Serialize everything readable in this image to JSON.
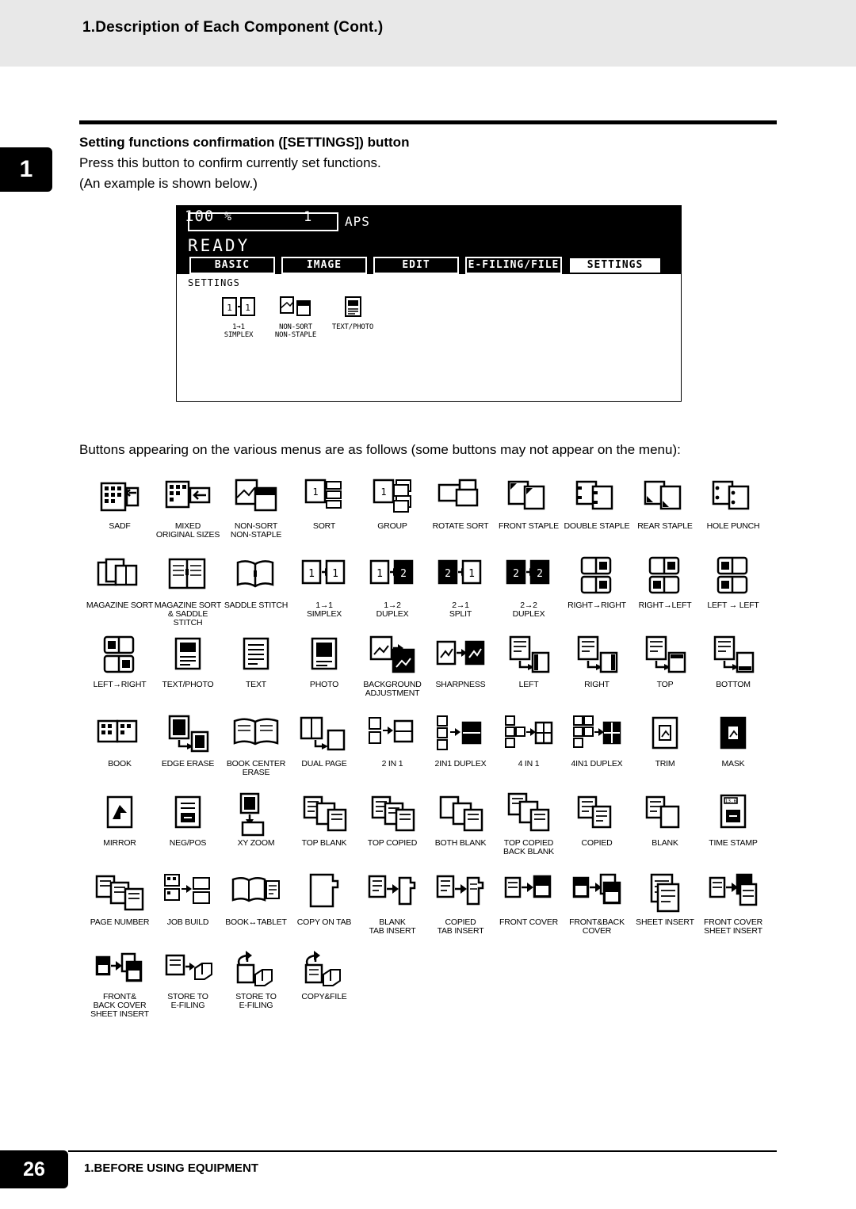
{
  "header": {
    "title": "1.Description of Each Component (Cont.)"
  },
  "chapter": {
    "number": "1"
  },
  "section": {
    "title": "Setting functions confirmation ([SETTINGS]) button",
    "line1": "Press this button to confirm currently set functions.",
    "line2": "(An example is shown below.)"
  },
  "lcd": {
    "ratio": "100",
    "percent": "%",
    "count": "1",
    "paper_mode": "APS",
    "status": "READY",
    "tabs": [
      {
        "label": "BASIC",
        "selected": false
      },
      {
        "label": "IMAGE",
        "selected": false
      },
      {
        "label": "EDIT",
        "selected": false
      },
      {
        "label": "E-FILING/FILE",
        "selected": false
      },
      {
        "label": "SETTINGS",
        "selected": true
      }
    ],
    "body_label": "SETTINGS",
    "items": [
      {
        "icon": "simplex-icon",
        "caption": "1→1\nSIMPLEX"
      },
      {
        "icon": "non-sort-icon",
        "caption": "NON-SORT\nNON-STAPLE"
      },
      {
        "icon": "text-photo-icon",
        "caption": "TEXT/PHOTO"
      }
    ]
  },
  "buttons_intro": "Buttons appearing on the various menus are as follows (some buttons may not appear on the menu):",
  "icon_grid": {
    "rows": [
      [
        {
          "icon": "sadf-icon",
          "caption": "SADF"
        },
        {
          "icon": "mixed-original-sizes-icon",
          "caption": "MIXED\nORIGINAL SIZES"
        },
        {
          "icon": "non-sort-non-staple-icon",
          "caption": "NON-SORT\nNON-STAPLE"
        },
        {
          "icon": "sort-icon",
          "caption": "SORT"
        },
        {
          "icon": "group-icon",
          "caption": "GROUP"
        },
        {
          "icon": "rotate-sort-icon",
          "caption": "ROTATE SORT"
        },
        {
          "icon": "front-staple-icon",
          "caption": "FRONT STAPLE"
        },
        {
          "icon": "double-staple-icon",
          "caption": "DOUBLE STAPLE"
        },
        {
          "icon": "rear-staple-icon",
          "caption": "REAR STAPLE"
        },
        {
          "icon": "hole-punch-icon",
          "caption": "HOLE PUNCH"
        }
      ],
      [
        {
          "icon": "magazine-sort-icon",
          "caption": "MAGAZINE SORT"
        },
        {
          "icon": "magazine-sort-saddle-stitch-icon",
          "caption": "MAGAZINE SORT\n& SADDLE STITCH"
        },
        {
          "icon": "saddle-stitch-icon",
          "caption": "SADDLE STITCH"
        },
        {
          "icon": "simplex-icon",
          "caption": "1→1\nSIMPLEX"
        },
        {
          "icon": "duplex-1-2-icon",
          "caption": "1→2\nDUPLEX"
        },
        {
          "icon": "split-icon",
          "caption": "2→1\nSPLIT"
        },
        {
          "icon": "duplex-2-2-icon",
          "caption": "2→2\nDUPLEX"
        },
        {
          "icon": "right-right-icon",
          "caption": "RIGHT→RIGHT"
        },
        {
          "icon": "right-left-icon",
          "caption": "RIGHT→LEFT"
        },
        {
          "icon": "left-left-icon",
          "caption": "LEFT → LEFT"
        }
      ],
      [
        {
          "icon": "left-right-icon",
          "caption": "LEFT→RIGHT"
        },
        {
          "icon": "text-photo-icon",
          "caption": "TEXT/PHOTO"
        },
        {
          "icon": "text-icon",
          "caption": "TEXT"
        },
        {
          "icon": "photo-icon",
          "caption": "PHOTO"
        },
        {
          "icon": "background-adjustment-icon",
          "caption": "BACKGROUND\nADJUSTMENT"
        },
        {
          "icon": "sharpness-icon",
          "caption": "SHARPNESS"
        },
        {
          "icon": "left-icon",
          "caption": "LEFT"
        },
        {
          "icon": "right-icon",
          "caption": "RIGHT"
        },
        {
          "icon": "top-icon",
          "caption": "TOP"
        },
        {
          "icon": "bottom-icon",
          "caption": "BOTTOM"
        }
      ],
      [
        {
          "icon": "book-icon",
          "caption": "BOOK"
        },
        {
          "icon": "edge-erase-icon",
          "caption": "EDGE ERASE"
        },
        {
          "icon": "book-center-erase-icon",
          "caption": "BOOK CENTER\nERASE"
        },
        {
          "icon": "dual-page-icon",
          "caption": "DUAL PAGE"
        },
        {
          "icon": "2in1-icon",
          "caption": "2 IN 1"
        },
        {
          "icon": "2in1-duplex-icon",
          "caption": "2IN1 DUPLEX"
        },
        {
          "icon": "4in1-icon",
          "caption": "4 IN 1"
        },
        {
          "icon": "4in1-duplex-icon",
          "caption": "4IN1 DUPLEX"
        },
        {
          "icon": "trim-icon",
          "caption": "TRIM"
        },
        {
          "icon": "mask-icon",
          "caption": "MASK"
        }
      ],
      [
        {
          "icon": "mirror-icon",
          "caption": "MIRROR"
        },
        {
          "icon": "neg-pos-icon",
          "caption": "NEG/POS"
        },
        {
          "icon": "xy-zoom-icon",
          "caption": "XY ZOOM"
        },
        {
          "icon": "top-blank-icon",
          "caption": "TOP BLANK"
        },
        {
          "icon": "top-copied-icon",
          "caption": "TOP COPIED"
        },
        {
          "icon": "both-blank-icon",
          "caption": "BOTH BLANK"
        },
        {
          "icon": "top-copied-back-blank-icon",
          "caption": "TOP COPIED\nBACK BLANK"
        },
        {
          "icon": "copied-icon",
          "caption": "COPIED"
        },
        {
          "icon": "blank-icon",
          "caption": "BLANK"
        },
        {
          "icon": "time-stamp-icon",
          "caption": "TIME STAMP"
        }
      ],
      [
        {
          "icon": "page-number-icon",
          "caption": "PAGE NUMBER"
        },
        {
          "icon": "job-build-icon",
          "caption": "JOB BUILD"
        },
        {
          "icon": "book-tablet-icon",
          "caption": "BOOK↔TABLET"
        },
        {
          "icon": "copy-on-tab-icon",
          "caption": "COPY ON TAB"
        },
        {
          "icon": "blank-tab-insert-icon",
          "caption": "BLANK\nTAB INSERT"
        },
        {
          "icon": "copied-tab-insert-icon",
          "caption": "COPIED\nTAB INSERT"
        },
        {
          "icon": "front-cover-icon",
          "caption": "FRONT COVER"
        },
        {
          "icon": "front-back-cover-icon",
          "caption": "FRONT&BACK\nCOVER"
        },
        {
          "icon": "sheet-insert-icon",
          "caption": "SHEET INSERT"
        },
        {
          "icon": "front-cover-sheet-insert-icon",
          "caption": "FRONT COVER\nSHEET INSERT"
        }
      ],
      [
        {
          "icon": "front-back-cover-sheet-insert-icon",
          "caption": "FRONT&\nBACK COVER\nSHEET INSERT"
        },
        {
          "icon": "store-to-e-filing-icon",
          "caption": "STORE TO\nE-FILING"
        },
        {
          "icon": "store-to-e-filing-2-icon",
          "caption": "STORE TO\nE-FILING"
        },
        {
          "icon": "copy-and-file-icon",
          "caption": "COPY&FILE"
        }
      ]
    ]
  },
  "footer": {
    "page_number": "26",
    "text": "1.BEFORE USING EQUIPMENT"
  }
}
